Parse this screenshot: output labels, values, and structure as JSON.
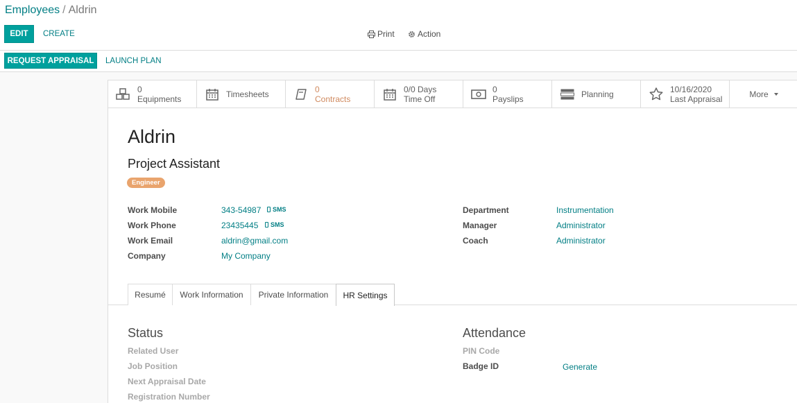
{
  "breadcrumb": {
    "parent": "Employees",
    "separator": "/",
    "current": "Aldrin"
  },
  "toolbar": {
    "edit_label": "EDIT",
    "create_label": "CREATE",
    "print_label": "Print",
    "action_label": "Action"
  },
  "statusbar": {
    "request_appraisal_label": "REQUEST APPRAISAL",
    "launch_plan_label": "LAUNCH PLAN"
  },
  "stat_buttons": {
    "equipments": {
      "num": "0",
      "label": "Equipments",
      "icon": "cubes-icon"
    },
    "timesheets": {
      "label": "Timesheets",
      "icon": "calendar-icon"
    },
    "contracts": {
      "num": "0",
      "label": "Contracts",
      "icon": "book-icon"
    },
    "time_off": {
      "num": "0/0 Days",
      "label": "Time Off",
      "icon": "calendar-icon"
    },
    "payslips": {
      "num": "0",
      "label": "Payslips",
      "icon": "money-icon"
    },
    "planning": {
      "label": "Planning",
      "icon": "tasks-icon"
    },
    "last_appraisal": {
      "num": "10/16/2020",
      "label": "Last Appraisal",
      "icon": "star-icon"
    },
    "more": {
      "label": "More"
    }
  },
  "employee": {
    "name": "Aldrin",
    "job_title": "Project Assistant",
    "tag": "Engineer"
  },
  "left_fields": {
    "work_mobile": {
      "label": "Work Mobile",
      "value": "343-54987",
      "sms": "SMS"
    },
    "work_phone": {
      "label": "Work Phone",
      "value": "23435445",
      "sms": "SMS"
    },
    "work_email": {
      "label": "Work Email",
      "value": "aldrin@gmail.com"
    },
    "company": {
      "label": "Company",
      "value": "My Company"
    }
  },
  "right_fields": {
    "department": {
      "label": "Department",
      "value": "Instrumentation"
    },
    "manager": {
      "label": "Manager",
      "value": "Administrator"
    },
    "coach": {
      "label": "Coach",
      "value": "Administrator"
    }
  },
  "tabs": {
    "resume": "Resumé",
    "work_information": "Work Information",
    "private_information": "Private Information",
    "hr_settings": "HR Settings"
  },
  "status_section": {
    "title": "Status",
    "related_user": "Related User",
    "job_position": "Job Position",
    "next_appraisal_date": "Next Appraisal Date",
    "registration_number": "Registration Number"
  },
  "attendance_section": {
    "title": "Attendance",
    "pin_code": "PIN Code",
    "badge_id": "Badge ID",
    "generate_label": "Generate"
  },
  "colors": {
    "brand": "#00a09d",
    "link": "#017e84",
    "tag": "#e9a46d",
    "warning": "#d08a5f"
  }
}
